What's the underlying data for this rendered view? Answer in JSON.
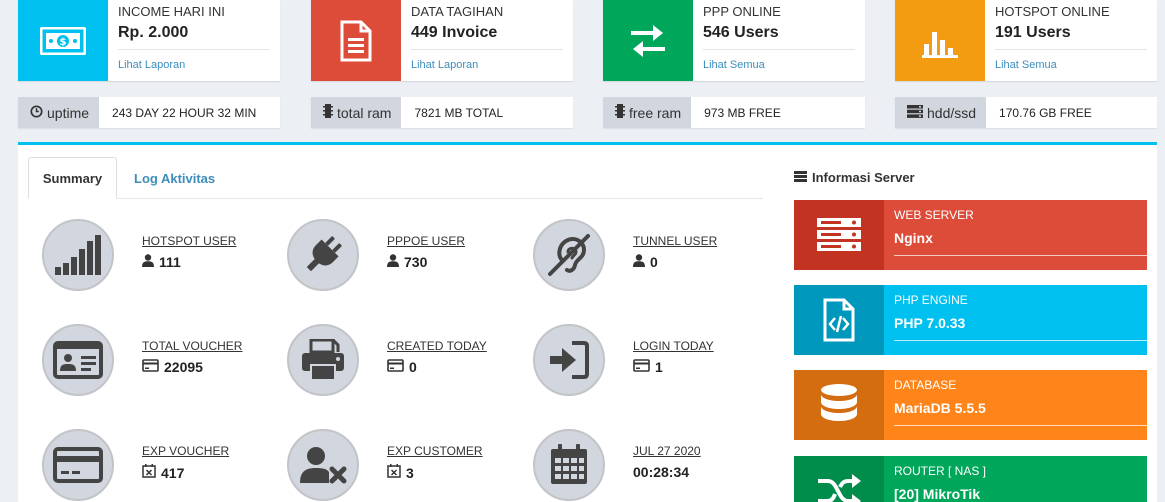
{
  "top_boxes": [
    {
      "label": "INCOME HARI INI",
      "value": "Rp. 2.000",
      "link": "Lihat Laporan",
      "color": "#00c0ef",
      "icon": "money-icon"
    },
    {
      "label": "DATA TAGIHAN",
      "value": "449 Invoice",
      "link": "Lihat Laporan",
      "color": "#dd4b39",
      "icon": "file-text-icon"
    },
    {
      "label": "PPP ONLINE",
      "value": "546 Users",
      "link": "Lihat Semua",
      "color": "#00a65a",
      "icon": "exchange-icon"
    },
    {
      "label": "HOTSPOT ONLINE",
      "value": "191 Users",
      "link": "Lihat Semua",
      "color": "#f39c12",
      "icon": "bar-chart-icon"
    }
  ],
  "stats": [
    {
      "label": "uptime",
      "value": "243 DAY 22 HOUR 32 MIN",
      "icon": "clock-icon"
    },
    {
      "label": "total ram",
      "value": "7821 MB TOTAL",
      "icon": "memory-icon"
    },
    {
      "label": "free ram",
      "value": "973 MB FREE",
      "icon": "memory-icon"
    },
    {
      "label": "hdd/ssd",
      "value": "170.76 GB FREE",
      "icon": "server-icon"
    }
  ],
  "tabs": {
    "summary": "Summary",
    "log": "Log Aktivitas"
  },
  "summary": [
    {
      "label": "HOTSPOT USER",
      "value": "111",
      "icon": "signal-icon",
      "value_icon": "user-icon"
    },
    {
      "label": "PPPOE USER",
      "value": "730",
      "icon": "plug-icon",
      "value_icon": "user-icon"
    },
    {
      "label": "TUNNEL USER",
      "value": "0",
      "icon": "deaf-icon",
      "value_icon": "user-icon"
    },
    {
      "label": "TOTAL VOUCHER",
      "value": "22095",
      "icon": "id-card-icon",
      "value_icon": "credit-card-icon"
    },
    {
      "label": "CREATED TODAY",
      "value": "0",
      "icon": "print-icon",
      "value_icon": "credit-card-icon"
    },
    {
      "label": "LOGIN TODAY",
      "value": "1",
      "icon": "sign-in-icon",
      "value_icon": "credit-card-icon"
    },
    {
      "label": "EXP VOUCHER",
      "value": "417",
      "icon": "credit-card-icon",
      "value_icon": "calendar-times-icon"
    },
    {
      "label": "EXP CUSTOMER",
      "value": "3",
      "icon": "user-times-icon",
      "value_icon": "calendar-times-icon"
    },
    {
      "label": "JUL 27 2020",
      "value": "00:28:34",
      "icon": "calendar-icon",
      "value_icon": ""
    }
  ],
  "server_info": {
    "title": "Informasi Server",
    "items": [
      {
        "label": "WEB SERVER",
        "value": "Nginx",
        "color": "#dd4b39",
        "icon_bg": "#c23321",
        "icon": "server-icon"
      },
      {
        "label": "PHP ENGINE",
        "value": "PHP 7.0.33",
        "color": "#00c0ef",
        "icon_bg": "#0097bc",
        "icon": "file-code-icon"
      },
      {
        "label": "DATABASE",
        "value": "MariaDB 5.5.5",
        "color": "#ff851b",
        "icon_bg": "#d46c10",
        "icon": "database-icon"
      },
      {
        "label": "ROUTER [ NAS ]",
        "value": "[20] MikroTik",
        "color": "#00a65a",
        "icon_bg": "#008d4c",
        "icon": "random-icon"
      }
    ]
  }
}
